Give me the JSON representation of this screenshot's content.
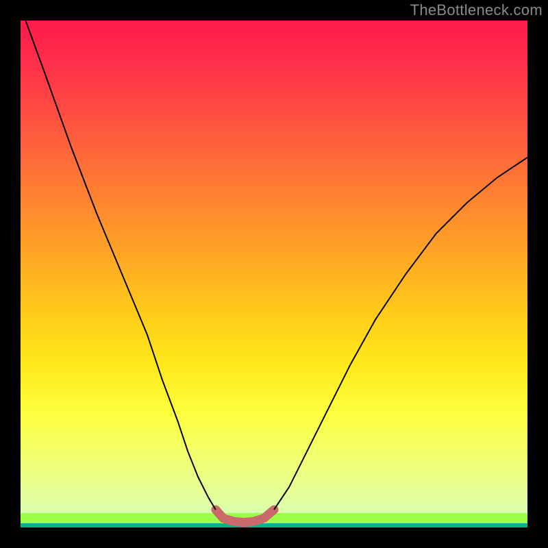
{
  "watermark": "TheBottleneck.com",
  "chart_data": {
    "type": "line",
    "title": "",
    "xlabel": "",
    "ylabel": "",
    "xlim": [
      0,
      100
    ],
    "ylim": [
      0,
      100
    ],
    "grid": false,
    "legend": false,
    "series": [
      {
        "name": "curve-left",
        "stroke": "#000000",
        "stroke_width": 2,
        "x": [
          1,
          5,
          10,
          15,
          20,
          25,
          28,
          31,
          33,
          35,
          37,
          38.5
        ],
        "values": [
          100,
          89,
          75,
          62,
          50,
          38,
          29,
          21,
          15,
          10,
          6,
          3.5
        ]
      },
      {
        "name": "curve-right",
        "stroke": "#000000",
        "stroke_width": 2,
        "x": [
          50,
          53,
          56,
          60,
          65,
          70,
          76,
          82,
          88,
          94,
          100
        ],
        "values": [
          3.5,
          8,
          14,
          22,
          32,
          41,
          50,
          58,
          64,
          69,
          73
        ]
      },
      {
        "name": "valley-highlight",
        "stroke": "#cb6a6a",
        "stroke_width": 13,
        "linecap": "round",
        "x": [
          38.5,
          40,
          42,
          44,
          46,
          48,
          50
        ],
        "values": [
          3.5,
          1.8,
          1.2,
          1.0,
          1.2,
          1.8,
          3.5
        ]
      }
    ]
  }
}
